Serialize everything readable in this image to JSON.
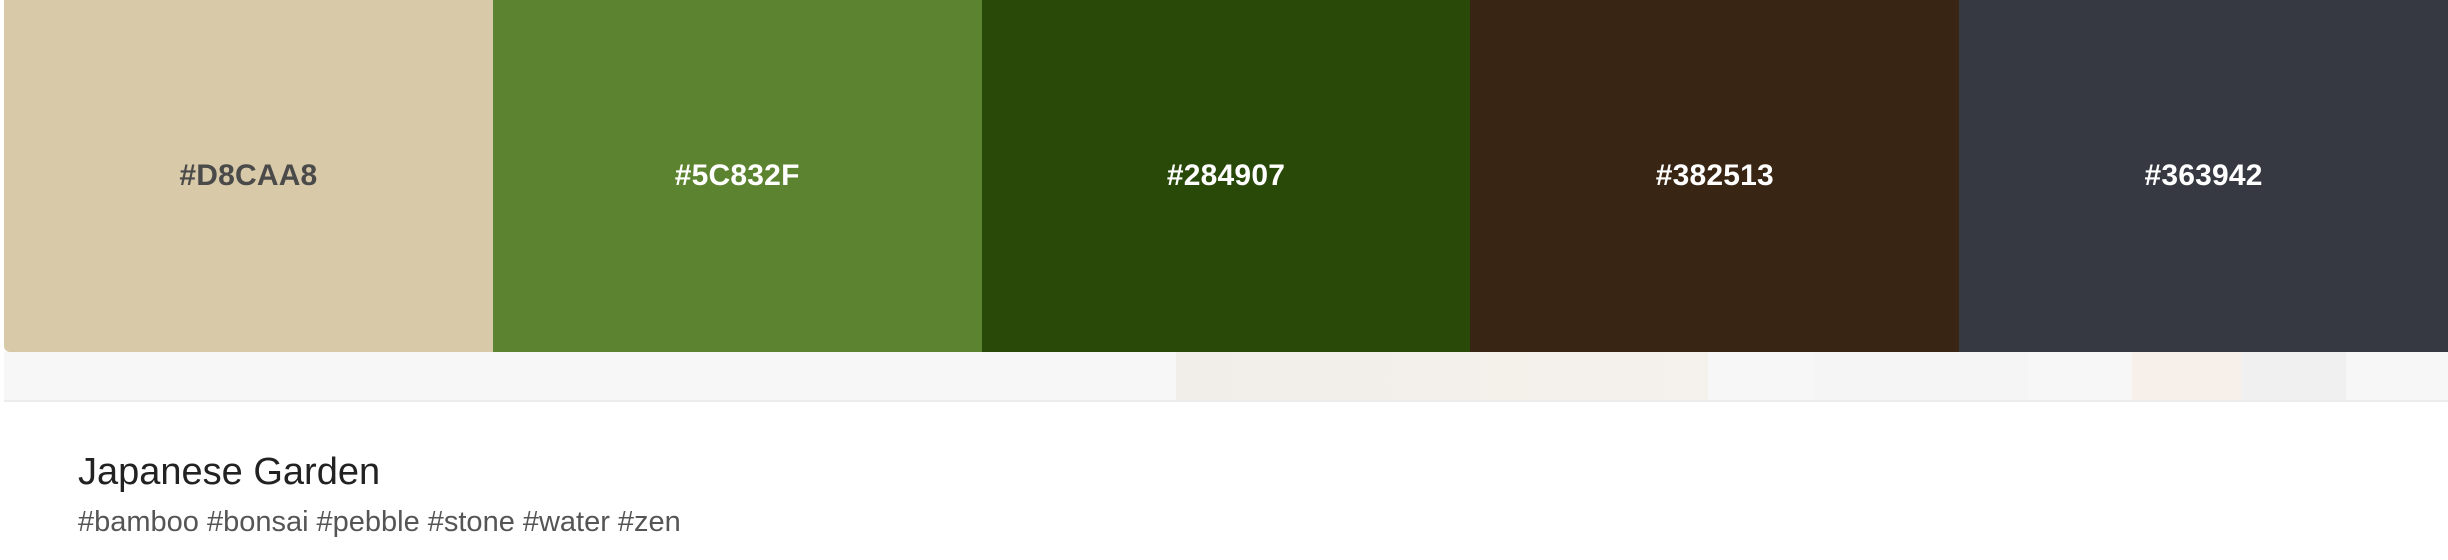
{
  "palette": {
    "swatches": [
      {
        "hex": "#D8CAA8",
        "label": "#D8CAA8",
        "text_color": "#4a4a4a"
      },
      {
        "hex": "#5C832F",
        "label": "#5C832F",
        "text_color": "#ffffff"
      },
      {
        "hex": "#284907",
        "label": "#284907",
        "text_color": "#ffffff"
      },
      {
        "hex": "#382513",
        "label": "#382513",
        "text_color": "#ffffff"
      },
      {
        "hex": "#363942",
        "label": "#363942",
        "text_color": "#ffffff"
      }
    ]
  },
  "info": {
    "title": "Japanese Garden",
    "tags": [
      "#bamboo",
      "#bonsai",
      "#pebble",
      "#stone",
      "#water",
      "#zen"
    ]
  }
}
